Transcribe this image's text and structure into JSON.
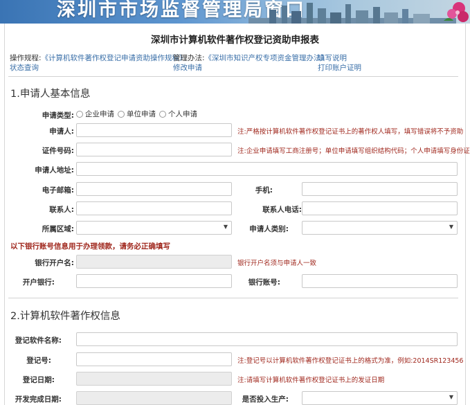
{
  "banner": {
    "title": "深圳市市场监督管理局窗口"
  },
  "form": {
    "title": "深圳市计算机软件著作权登记资助申报表"
  },
  "info": {
    "procedure_label": "操作规程:",
    "procedure_link": "《计算机软件著作权登记申请资助操作规程》",
    "status_link": "状态查询",
    "measures_label": "管理办法:",
    "measures_link": "《深圳市知识产权专项资金管理办法》",
    "modify_link": "修改申请",
    "fill_link": "填写说明",
    "print_link": "打印账户证明"
  },
  "section1": {
    "title": "1.申请人基本信息",
    "type_label": "申请类型:",
    "type_options": [
      "企业申请",
      "单位申请",
      "个人申请"
    ],
    "applicant_label": "申请人:",
    "applicant_hint": "注:严格按计算机软件著作权登记证书上的著作权人填写，填写错误将不予资助",
    "cert_label": "证件号码:",
    "cert_hint": "注:企业申请填写工商注册号；单位申请填写组织结构代码；个人申请填写身份证号码",
    "address_label": "申请人地址:",
    "email_label": "电子邮箱:",
    "mobile_label": "手机:",
    "contact_label": "联系人:",
    "contact_phone_label": "联系人电话:",
    "region_label": "所属区域:",
    "category_label": "申请人类别:",
    "bank_notice": "以下银行账号信息用于办理领款，请务必正确填写",
    "bank_name_label": "银行开户名:",
    "bank_name_hint": "银行开户名须与申请人一致",
    "bank_label": "开户银行:",
    "account_label": "银行账号:"
  },
  "section2": {
    "title": "2.计算机软件著作权信息",
    "software_label": "登记软件名称:",
    "regno_label": "登记号:",
    "regno_hint": "注:登记号以计算机软件著作权登记证书上的格式为准，例如:2014SR123456",
    "regdate_label": "登记日期:",
    "regdate_hint": "注:请填写计算机软件著作权登记证书上的发证日期",
    "devdate_label": "开发完成日期:",
    "production_label": "是否投入生产:"
  },
  "icons": {
    "dropdown": "chevron-down-icon",
    "radio": "radio-icon"
  },
  "colors": {
    "hint": "#a0281e",
    "link": "#3a6fa8",
    "banner": "#3a74b4"
  }
}
